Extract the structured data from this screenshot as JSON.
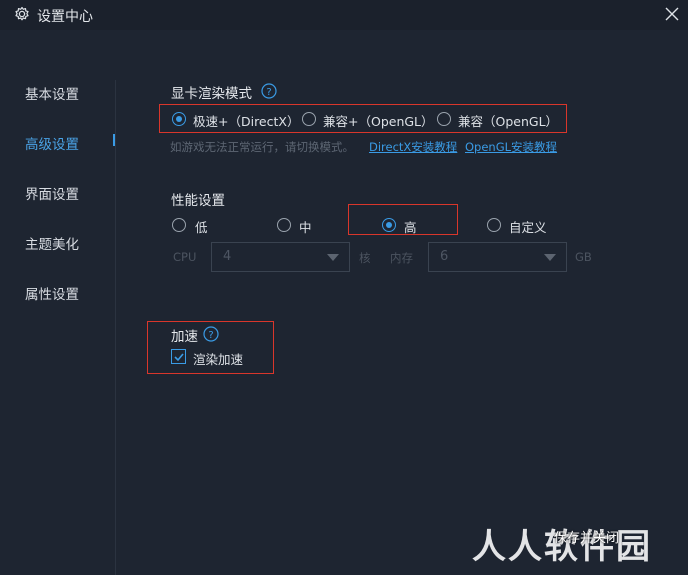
{
  "window": {
    "title": "设置中心"
  },
  "sidebar": {
    "items": [
      {
        "label": "基本设置"
      },
      {
        "label": "高级设置"
      },
      {
        "label": "界面设置"
      },
      {
        "label": "主题美化"
      },
      {
        "label": "属性设置"
      }
    ]
  },
  "render_mode": {
    "title": "显卡渲染模式",
    "options": [
      {
        "label": "极速+（DirectX）",
        "selected": true
      },
      {
        "label": "兼容+（OpenGL）",
        "selected": false
      },
      {
        "label": "兼容（OpenGL）",
        "selected": false
      }
    ],
    "hint": "如游戏无法正常运行，请切换模式。",
    "link_directx": "DirectX安装教程",
    "link_opengl": "OpenGL安装教程"
  },
  "performance": {
    "title": "性能设置",
    "options": [
      {
        "label": "低",
        "selected": false
      },
      {
        "label": "中",
        "selected": false
      },
      {
        "label": "高",
        "selected": true
      },
      {
        "label": "自定义",
        "selected": false
      }
    ],
    "cpu_label": "CPU",
    "cpu_value": "4",
    "cpu_unit": "核",
    "mem_label": "内存",
    "mem_value": "6",
    "mem_unit": "GB"
  },
  "acceleration": {
    "title": "加速",
    "checkbox_label": "渲染加速",
    "checked": true
  },
  "footer": {
    "save_button": "保存并关闭",
    "watermark": "人人软件园"
  },
  "colors": {
    "accent": "#3a9be5",
    "background": "#1e2531",
    "highlight_box": "#d9362b"
  }
}
